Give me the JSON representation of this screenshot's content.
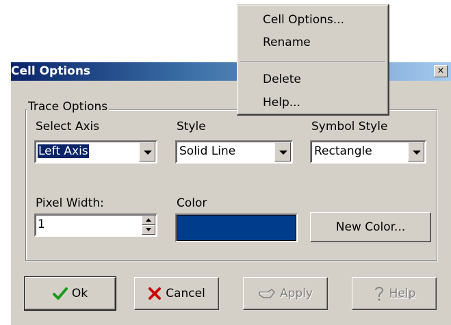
{
  "dialog": {
    "title": "Cell Options",
    "close_glyph": "×",
    "group_label": "Trace Options",
    "select_axis": {
      "label": "Select Axis",
      "value": "Left Axis"
    },
    "style": {
      "label": "Style",
      "value": "Solid Line"
    },
    "symbol_style": {
      "label": "Symbol Style",
      "value": "Rectangle"
    },
    "pixel_width": {
      "label": "Pixel Width:",
      "value": "1"
    },
    "color": {
      "label": "Color",
      "swatch": "#003c8c"
    },
    "new_color_button": "New Color...",
    "buttons": {
      "ok": "Ok",
      "cancel": "Cancel",
      "apply": "Apply",
      "help": "Help"
    }
  },
  "context_menu": {
    "items": [
      "Cell Options...",
      "Rename",
      "Delete",
      "Help..."
    ]
  },
  "colors": {
    "dialog_bg": "#d4d0c8",
    "title_gradient_start": "#0a246a",
    "title_gradient_end": "#a6caf0",
    "selection": "#0a246a",
    "ok_check": "#1a9a1a",
    "cancel_x": "#cc0000"
  },
  "icons": {
    "ok": "checkmark-icon",
    "cancel": "x-icon",
    "apply": "pointing-hand-icon",
    "help": "question-mark-icon"
  }
}
